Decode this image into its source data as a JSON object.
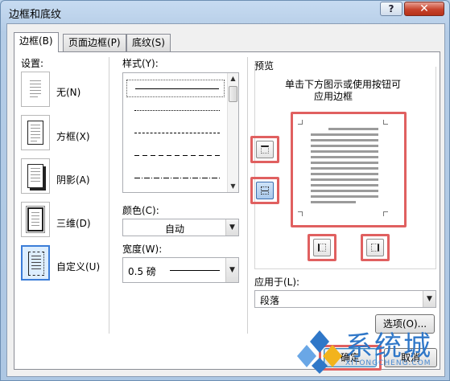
{
  "window": {
    "title": "边框和底纹",
    "help_label": "?",
    "close_label": "✕"
  },
  "tabs": [
    {
      "label": "边框(B)",
      "active": true
    },
    {
      "label": "页面边框(P)",
      "active": false
    },
    {
      "label": "底纹(S)",
      "active": false
    }
  ],
  "settings": {
    "heading": "设置:",
    "items": [
      {
        "label": "无(N)",
        "icon": "setting-none-icon"
      },
      {
        "label": "方框(X)",
        "icon": "setting-box-icon"
      },
      {
        "label": "阴影(A)",
        "icon": "setting-shadow-icon"
      },
      {
        "label": "三维(D)",
        "icon": "setting-3d-icon"
      },
      {
        "label": "自定义(U)",
        "icon": "setting-custom-icon"
      }
    ],
    "selected": "自定义(U)"
  },
  "style": {
    "heading": "样式(Y):",
    "line_styles": [
      "solid",
      "dotted",
      "dashed",
      "long-dashed",
      "dash-dot"
    ],
    "selected": "solid"
  },
  "color": {
    "label": "颜色(C):",
    "value": "自动"
  },
  "width": {
    "label": "宽度(W):",
    "value": "0.5 磅"
  },
  "preview": {
    "heading": "预览",
    "instruction_line1": "单击下方图示或使用按钮可",
    "instruction_line2": "应用边框"
  },
  "apply_to": {
    "label": "应用于(L):",
    "value": "段落"
  },
  "buttons": {
    "options": "选项(O)...",
    "ok": "确定",
    "cancel": "取消"
  },
  "watermark": {
    "text": "系统城",
    "sub": "XITONGCHENG.COM"
  },
  "colors": {
    "highlight": "#e06060",
    "selection": "#3b7dd8"
  }
}
